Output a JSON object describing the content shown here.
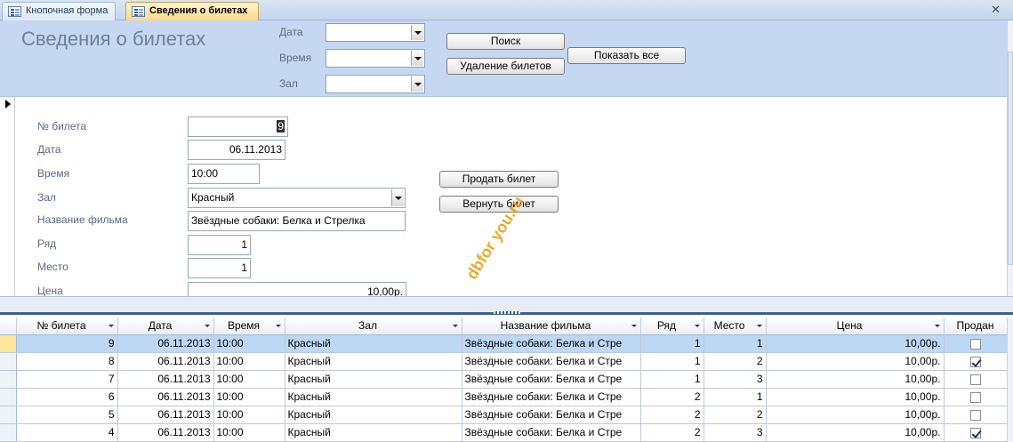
{
  "tabs": [
    {
      "label": "Кнопочная форма"
    },
    {
      "label": "Сведения о билетах"
    }
  ],
  "header": {
    "title": "Сведения о билетах",
    "filter_date_label": "Дата",
    "filter_time_label": "Время",
    "filter_hall_label": "Зал",
    "search_button": "Поиск",
    "delete_button": "Удаление билетов",
    "show_all_button": "Показать все"
  },
  "detail": {
    "ticket_no_label": "№ билета",
    "ticket_no_value": "9",
    "date_label": "Дата",
    "date_value": "06.11.2013",
    "time_label": "Время",
    "time_value": "10:00",
    "hall_label": "Зал",
    "hall_value": "Красный",
    "film_label": "Название фильма",
    "film_value": "Звёздные собаки: Белка и Стрелка",
    "row_label": "Ряд",
    "row_value": "1",
    "seat_label": "Место",
    "seat_value": "1",
    "price_label": "Цена",
    "price_value": "10,00р.",
    "sell_button": "Продать билет",
    "return_button": "Вернуть билет",
    "watermark": "dbfor you.ru"
  },
  "grid": {
    "columns": [
      "№ билета",
      "Дата",
      "Время",
      "Зал",
      "Название фильма",
      "Ряд",
      "Место",
      "Цена",
      "Продан"
    ],
    "rows": [
      {
        "no": "9",
        "date": "06.11.2013",
        "time": "10:00",
        "hall": "Красный",
        "film": "Звёздные собаки: Белка и Стре",
        "row": "1",
        "seat": "1",
        "price": "10,00р.",
        "sold": false
      },
      {
        "no": "8",
        "date": "06.11.2013",
        "time": "10:00",
        "hall": "Красный",
        "film": "Звёздные собаки: Белка и Стре",
        "row": "1",
        "seat": "2",
        "price": "10,00р.",
        "sold": true
      },
      {
        "no": "7",
        "date": "06.11.2013",
        "time": "10:00",
        "hall": "Красный",
        "film": "Звёздные собаки: Белка и Стре",
        "row": "1",
        "seat": "3",
        "price": "10,00р.",
        "sold": false
      },
      {
        "no": "6",
        "date": "06.11.2013",
        "time": "10:00",
        "hall": "Красный",
        "film": "Звёздные собаки: Белка и Стре",
        "row": "2",
        "seat": "1",
        "price": "10,00р.",
        "sold": false
      },
      {
        "no": "5",
        "date": "06.11.2013",
        "time": "10:00",
        "hall": "Красный",
        "film": "Звёздные собаки: Белка и Стре",
        "row": "2",
        "seat": "2",
        "price": "10,00р.",
        "sold": false
      },
      {
        "no": "4",
        "date": "06.11.2013",
        "time": "10:00",
        "hall": "Красный",
        "film": "Звёздные собаки: Белка и Стре",
        "row": "2",
        "seat": "3",
        "price": "10,00р.",
        "sold": true
      }
    ]
  },
  "colors": {
    "header_bg": "#c6d8f1",
    "active_tab": "#ffd88a",
    "current_row": "#bcd8f5"
  }
}
